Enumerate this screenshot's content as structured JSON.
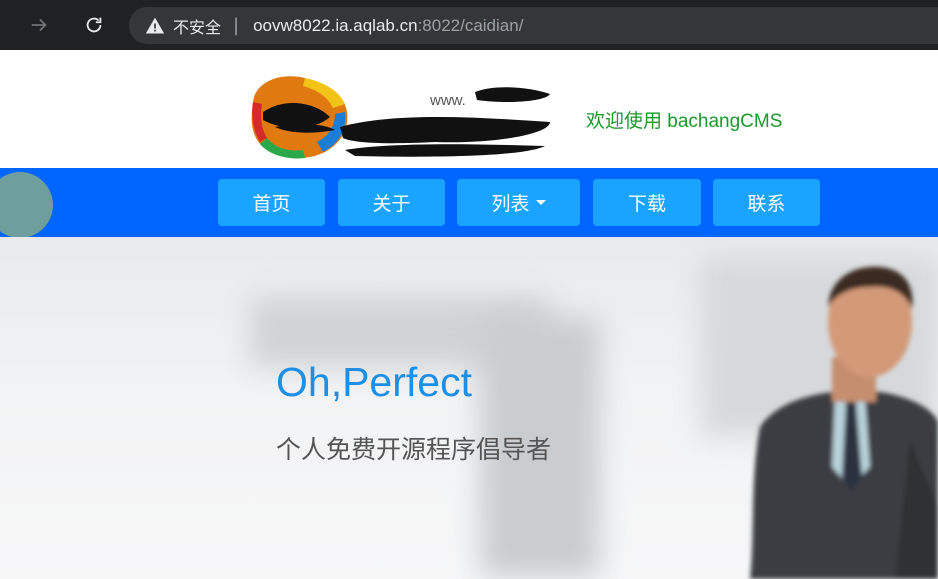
{
  "browser": {
    "security_label": "不安全",
    "url_host": "oovw8022.ia.aqlab.cn",
    "url_rest": ":8022/caidian/"
  },
  "header": {
    "logo_text": "www.",
    "welcome": "欢迎使用 bachangCMS"
  },
  "nav": {
    "items": [
      {
        "label": "首页"
      },
      {
        "label": "关于"
      },
      {
        "label": "列表"
      },
      {
        "label": "下载"
      },
      {
        "label": "联系"
      }
    ]
  },
  "hero": {
    "title": "Oh,Perfect",
    "subtitle": "个人免费开源程序倡导者"
  },
  "colors": {
    "nav_bg": "#0066ff",
    "nav_item_bg": "#1aa3ff",
    "welcome": "#1a9a2a",
    "hero_title": "#1e8fe6"
  }
}
